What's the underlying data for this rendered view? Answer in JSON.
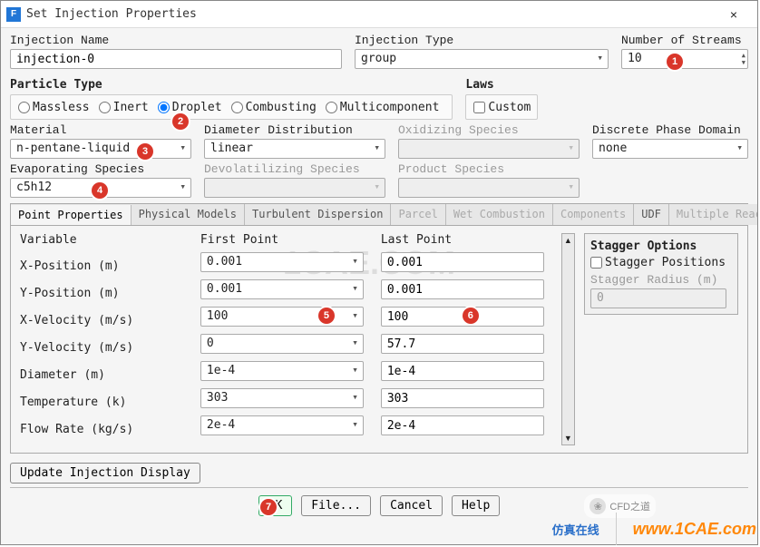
{
  "window": {
    "title": "Set Injection Properties",
    "close": "×"
  },
  "top": {
    "injection_name_label": "Injection Name",
    "injection_name": "injection-0",
    "injection_type_label": "Injection Type",
    "injection_type": "group",
    "num_streams_label": "Number of Streams",
    "num_streams": "10"
  },
  "particle": {
    "section": "Particle Type",
    "massless": "Massless",
    "inert": "Inert",
    "droplet": "Droplet",
    "combusting": "Combusting",
    "multicomponent": "Multicomponent"
  },
  "laws": {
    "section": "Laws",
    "custom": "Custom"
  },
  "grid": {
    "material_label": "Material",
    "material": "n-pentane-liquid",
    "diam_label": "Diameter Distribution",
    "diam": "linear",
    "ox_label": "Oxidizing Species",
    "ox": "",
    "dpd_label": "Discrete Phase Domain",
    "dpd": "none",
    "evap_label": "Evaporating Species",
    "evap": "c5h12",
    "devol_label": "Devolatilizing Species",
    "devol": "",
    "prod_label": "Product Species",
    "prod": ""
  },
  "tabs": {
    "point": "Point Properties",
    "physical": "Physical Models",
    "turb": "Turbulent Dispersion",
    "parcel": "Parcel",
    "wet": "Wet Combustion",
    "comp": "Components",
    "udf": "UDF",
    "mult": "Multiple Reactions"
  },
  "props": {
    "var_head": "Variable",
    "first_head": "First Point",
    "last_head": "Last Point",
    "vars": {
      "xpos": "X-Position (m)",
      "ypos": "Y-Position (m)",
      "xvel": "X-Velocity (m/s)",
      "yvel": "Y-Velocity (m/s)",
      "diam": "Diameter (m)",
      "temp": "Temperature (k)",
      "flow": "Flow Rate (kg/s)"
    },
    "first": {
      "xpos": "0.001",
      "ypos": "0.001",
      "xvel": "100",
      "yvel": "0",
      "diam": "1e-4",
      "temp": "303",
      "flow": "2e-4"
    },
    "last": {
      "xpos": "0.001",
      "ypos": "0.001",
      "xvel": "100",
      "yvel": "57.7",
      "diam": "1e-4",
      "temp": "303",
      "flow": "2e-4"
    }
  },
  "stagger": {
    "section": "Stagger Options",
    "positions": "Stagger Positions",
    "radius_label": "Stagger Radius (m)",
    "radius": "0"
  },
  "buttons": {
    "update": "Update Injection Display",
    "ok": "OK",
    "file": "File...",
    "cancel": "Cancel",
    "help": "Help"
  },
  "badges": {
    "b1": "1",
    "b2": "2",
    "b3": "3",
    "b4": "4",
    "b5": "5",
    "b6": "6",
    "b7": "7"
  },
  "watermarks": {
    "center": "1CAE.COM"
  },
  "footer": {
    "wx": "CFD之道",
    "brand1": "仿真在线",
    "brand2": "www.1CAE.com"
  }
}
